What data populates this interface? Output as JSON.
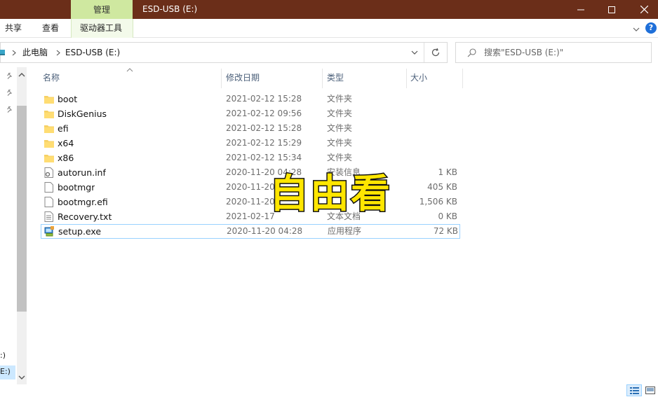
{
  "window": {
    "title": "ESD-USB (E:)",
    "context_tab": "管理",
    "controls": {
      "minimize": "minimize-icon",
      "maximize": "maximize-icon",
      "close": "close-icon"
    },
    "titlebar_color": "#6b2e19",
    "context_tab_color": "#cfe8a0"
  },
  "ribbon": {
    "tabs": [
      {
        "label": "共享"
      },
      {
        "label": "查看"
      },
      {
        "label": "驱动器工具"
      }
    ],
    "help": "?"
  },
  "address": {
    "crumbs": [
      "此电脑",
      "ESD-USB (E:)"
    ],
    "search_placeholder": "搜索\"ESD-USB (E:)\""
  },
  "nav": {
    "drive_labels": [
      ":)",
      "E:)"
    ]
  },
  "columns": {
    "name": "名称",
    "date": "修改日期",
    "type": "类型",
    "size": "大小"
  },
  "files": [
    {
      "name": "boot",
      "date": "2021-02-12 15:28",
      "type": "文件夹",
      "size": "",
      "icon": "folder-icon"
    },
    {
      "name": "DiskGenius",
      "date": "2021-02-12 09:56",
      "type": "文件夹",
      "size": "",
      "icon": "folder-icon"
    },
    {
      "name": "efi",
      "date": "2021-02-12 15:28",
      "type": "文件夹",
      "size": "",
      "icon": "folder-icon"
    },
    {
      "name": "x64",
      "date": "2021-02-12 15:29",
      "type": "文件夹",
      "size": "",
      "icon": "folder-icon"
    },
    {
      "name": "x86",
      "date": "2021-02-12 15:34",
      "type": "文件夹",
      "size": "",
      "icon": "folder-icon"
    },
    {
      "name": "autorun.inf",
      "date": "2020-11-20 04:28",
      "type": "安装信息",
      "size": "1 KB",
      "icon": "settings-file-icon"
    },
    {
      "name": "bootmgr",
      "date": "2020-11-20",
      "type": "",
      "size": "405 KB",
      "icon": "file-icon"
    },
    {
      "name": "bootmgr.efi",
      "date": "2020-11-20",
      "type": "",
      "size": "1,506 KB",
      "icon": "file-icon"
    },
    {
      "name": "Recovery.txt",
      "date": "2021-02-17 ",
      "type": "文本文档",
      "size": "0 KB",
      "icon": "text-file-icon"
    },
    {
      "name": "setup.exe",
      "date": "2020-11-20 04:28",
      "type": "应用程序",
      "size": "72 KB",
      "icon": "setup-exe-icon"
    }
  ],
  "watermark": "自由看"
}
